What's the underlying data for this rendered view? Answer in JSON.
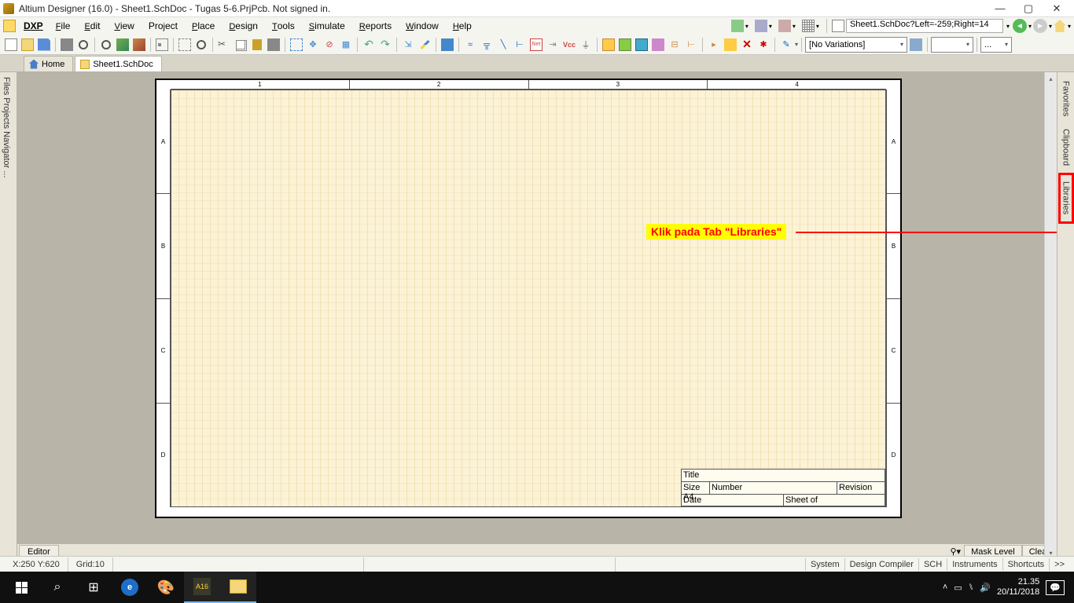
{
  "titlebar": {
    "title": "Altium Designer (16.0) - Sheet1.SchDoc - Tugas 5-6.PrjPcb. Not signed in."
  },
  "menu": {
    "dxp": "DXP",
    "items": [
      "File",
      "Edit",
      "View",
      "Project",
      "Place",
      "Design",
      "Tools",
      "Simulate",
      "Reports",
      "Window",
      "Help"
    ],
    "address": "Sheet1.SchDoc?Left=-259;Right=14"
  },
  "toolbar": {
    "variations": "[No Variations]"
  },
  "tabs": {
    "home": "Home",
    "doc": "Sheet1.SchDoc"
  },
  "left_panel": "Files  Projects  Navigator ...",
  "right_panel": {
    "favorites": "Favorites",
    "clipboard": "Clipboard",
    "libraries": "Libraries"
  },
  "callout": "Klik pada Tab \"Libraries\"",
  "sheet": {
    "cols": [
      "1",
      "2",
      "3",
      "4"
    ],
    "rows": [
      "A",
      "B",
      "C",
      "D"
    ],
    "titleblock": {
      "title_lbl": "Title",
      "size_lbl": "Size",
      "size": "A4",
      "number_lbl": "Number",
      "rev_lbl": "Revision",
      "date_lbl": "Date",
      "sheet_lbl": "Sheet  of"
    }
  },
  "editor_tab": "Editor",
  "editor_right": {
    "mask": "Mask Level",
    "clear": "Clear"
  },
  "status": {
    "coords": "X:250 Y:620",
    "grid": "Grid:10",
    "buttons": [
      "System",
      "Design Compiler",
      "SCH",
      "Instruments",
      "Shortcuts",
      ">>"
    ]
  },
  "taskbar": {
    "time": "21.35",
    "date": "20/11/2018"
  }
}
